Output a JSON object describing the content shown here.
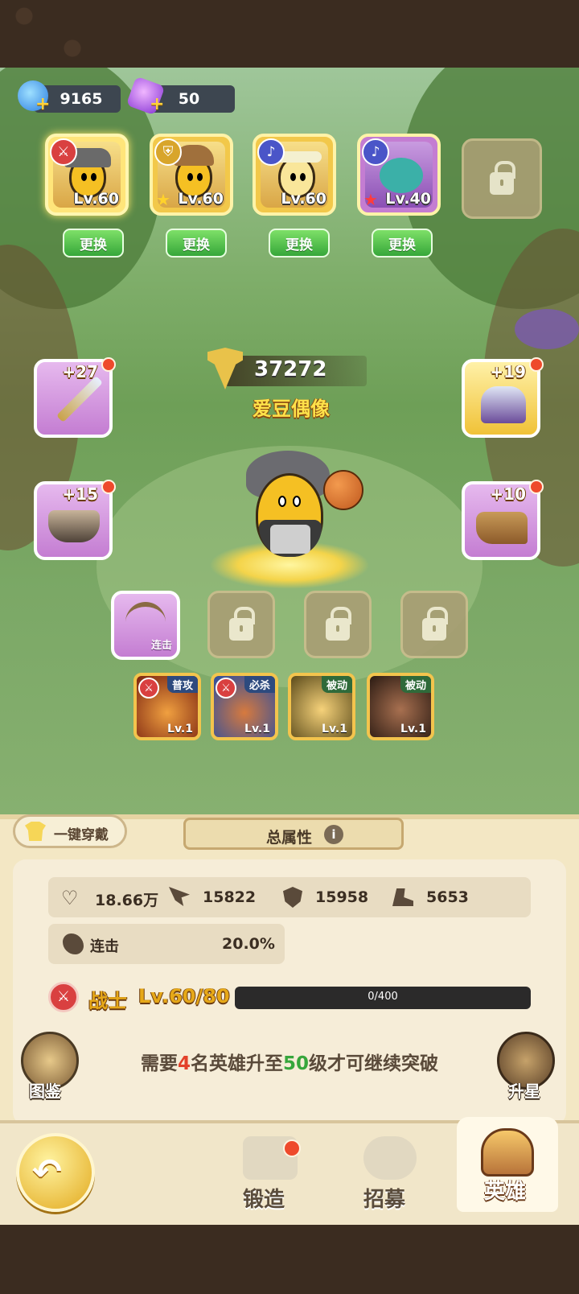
{
  "resources": {
    "energy": "9165",
    "gems": "50"
  },
  "team": [
    {
      "level": "Lv.60",
      "class_icon": "sword-icon",
      "class_color": "#d94040"
    },
    {
      "level": "Lv.60",
      "class_icon": "shield-icon",
      "class_color": "#d8a52b"
    },
    {
      "level": "Lv.60",
      "class_icon": "staff-icon",
      "class_color": "#4a55c8"
    },
    {
      "level": "Lv.40",
      "class_icon": "staff-icon",
      "class_color": "#4a55c8"
    }
  ],
  "swap_label": "更换",
  "hero": {
    "power": "37272",
    "name": "爱豆偶像"
  },
  "equipment": {
    "weapon": "+27",
    "armor": "+19",
    "belt": "+15",
    "boots": "+10"
  },
  "combo_skill_label": "连击",
  "skills": [
    {
      "tag": "普攻",
      "level": "Lv.1"
    },
    {
      "tag": "必杀",
      "level": "Lv.1"
    },
    {
      "tag": "被动",
      "level": "Lv.1"
    },
    {
      "tag": "被动",
      "level": "Lv.1"
    }
  ],
  "equip_all_label": "一键穿戴",
  "total_attr_label": "总属性",
  "stats": {
    "hp": "18.66万",
    "atk": "15822",
    "def": "15958",
    "spd": "5653",
    "combo_label": "连击",
    "combo_value": "20.0%"
  },
  "class_bar": {
    "class_name": "战士",
    "level": "Lv.60/80",
    "progress_text": "0/400",
    "progress": 0
  },
  "breakthrough": {
    "pre": "需要",
    "count": "4",
    "mid": "名英雄升至",
    "level": "50",
    "post": "级才可继续突破"
  },
  "side_buttons": {
    "codex": "图鉴",
    "star_up": "升星"
  },
  "nav": {
    "forge": "锻造",
    "recruit": "招募",
    "heroes": "英雄"
  },
  "colors": {
    "accent_green": "#37a63c",
    "accent_red": "#e3412a",
    "gold": "#f3c44d",
    "purple": "#c47dd2"
  }
}
